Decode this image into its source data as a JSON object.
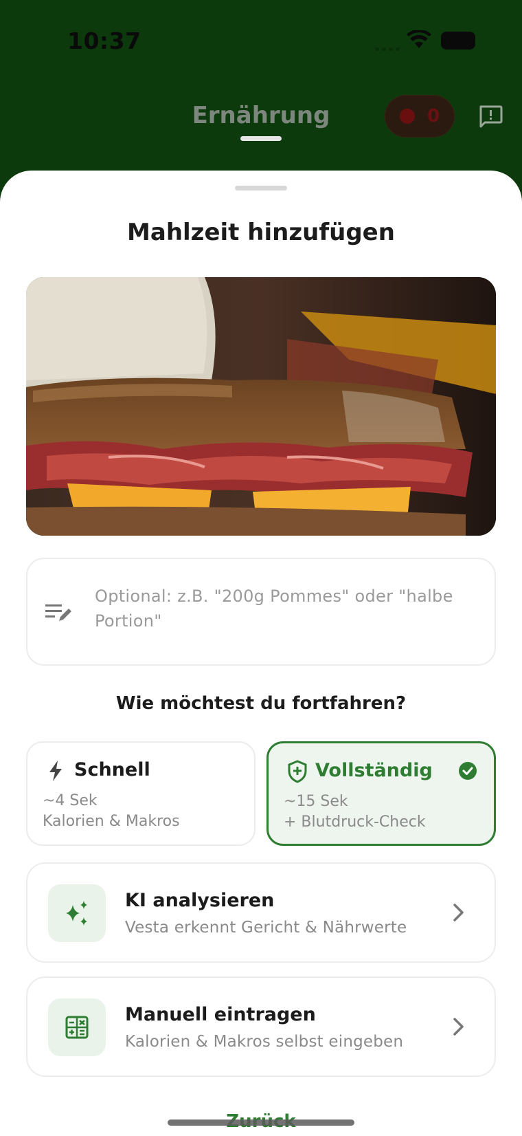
{
  "status_bar": {
    "time": "10:37"
  },
  "header": {
    "title": "Ernährung",
    "counter_value": "0"
  },
  "sheet": {
    "title": "Mahlzeit hinzufügen",
    "note_placeholder": "Optional: z.B. \"200g Pommes\" oder \"halbe Portion\"",
    "question": "Wie möchtest du fortfahren?",
    "modes": [
      {
        "label": "Schnell",
        "line1": "~4 Sek",
        "line2": "Kalorien & Makros",
        "selected": false
      },
      {
        "label": "Vollständig",
        "line1": "~15 Sek",
        "line2": "+ Blutdruck-Check",
        "selected": true
      }
    ],
    "actions": [
      {
        "title": "KI analysieren",
        "subtitle": "Vesta erkennt Gericht & Nährwerte",
        "icon": "sparkles-icon"
      },
      {
        "title": "Manuell eintragen",
        "subtitle": "Kalorien & Makros selbst eingeben",
        "icon": "calculator-icon"
      }
    ],
    "back_label": "Zurück"
  },
  "colors": {
    "header_bg": "#0c3a0c",
    "accent_green": "#2e7d32",
    "selected_bg": "#edf5ee"
  }
}
